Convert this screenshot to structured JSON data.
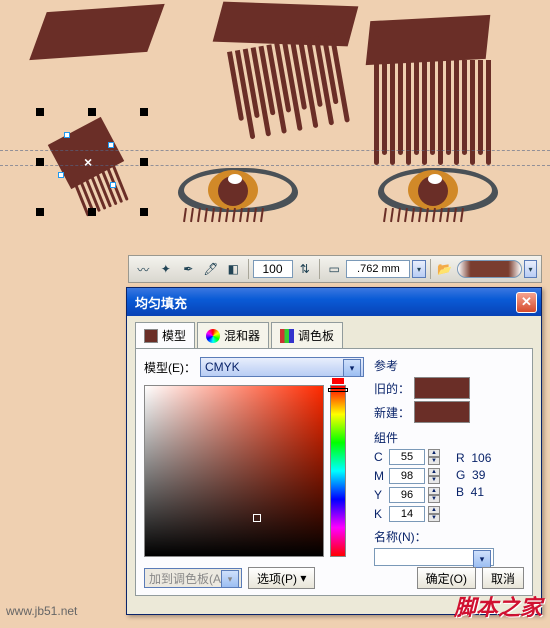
{
  "toolbar": {
    "opacity": "100",
    "stroke": ".762 mm"
  },
  "dialog": {
    "title": "均匀填充",
    "tabs": {
      "model": "模型",
      "mixer": "混和器",
      "palette": "调色板"
    },
    "model_label": "模型(E)：",
    "model_value": "CMYK",
    "reference": {
      "heading": "参考",
      "old": "旧的：",
      "new": "新建："
    },
    "components": {
      "heading": "組件",
      "c": "55",
      "m": "98",
      "y": "96",
      "k": "14",
      "r": "106",
      "g": "39",
      "b": "41"
    },
    "name_label": "名称(N)：",
    "name_value": "",
    "buttons": {
      "add_palette": "加到调色板(A)",
      "options": "选项(P)",
      "ok": "确定(O)",
      "cancel": "取消"
    }
  },
  "colors": {
    "swatch": "#6a2e27"
  },
  "watermark": {
    "brand": "脚本之家",
    "url": "www.jb51.net"
  }
}
